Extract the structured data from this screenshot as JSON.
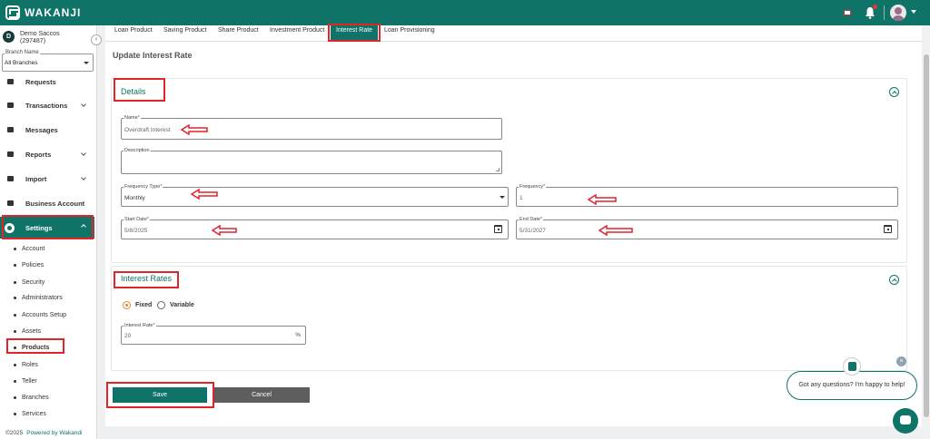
{
  "app": {
    "brand": "WAKANJI"
  },
  "org": {
    "initial": "D",
    "name": "Demo Saccos",
    "code": "(297487)"
  },
  "branch": {
    "label": "Branch Name",
    "value": "All Branches"
  },
  "nav": {
    "requests": "Requests",
    "transactions": "Transactions",
    "messages": "Messages",
    "reports": "Reports",
    "import": "Import",
    "business_account": "Business Account",
    "settings": "Settings"
  },
  "settings_sub": [
    "Account",
    "Policies",
    "Security",
    "Administrators",
    "Accounts Setup",
    "Assets",
    "Products",
    "Roles",
    "Teller",
    "Branches",
    "Services"
  ],
  "footer": {
    "copyright": "©2025",
    "powered": "Powered by Wakandi"
  },
  "tabs": [
    "Loan Product",
    "Saving Product",
    "Share Product",
    "Investment Product",
    "Interest Rate",
    "Loan Provisioning"
  ],
  "page_title": "Update Interest Rate",
  "details": {
    "title": "Details",
    "name": {
      "label": "Name",
      "value": "Overdraft Interest"
    },
    "description": {
      "label": "Description",
      "value": ""
    },
    "frequency_type": {
      "label": "Frequency Type",
      "value": "Monthly"
    },
    "frequency": {
      "label": "Frequency",
      "value": "1"
    },
    "start_date": {
      "label": "Start Date",
      "value": "5/8/2025"
    },
    "end_date": {
      "label": "End Date",
      "value": "5/31/2027"
    }
  },
  "interest_rates": {
    "title": "Interest Rates",
    "options": [
      "Fixed",
      "Variable"
    ],
    "selected": "Fixed",
    "rate": {
      "label": "Interest Rate",
      "value": "20",
      "suffix": "%"
    }
  },
  "buttons": {
    "save": "Save",
    "cancel": "Cancel"
  },
  "chat": {
    "message": "Got any questions? I'm happy to help!",
    "close": "×"
  },
  "colors": {
    "primary": "#0f7368",
    "annotation": "#e0242a",
    "radio": "#e0892a",
    "cancel": "#5e5e5e"
  }
}
